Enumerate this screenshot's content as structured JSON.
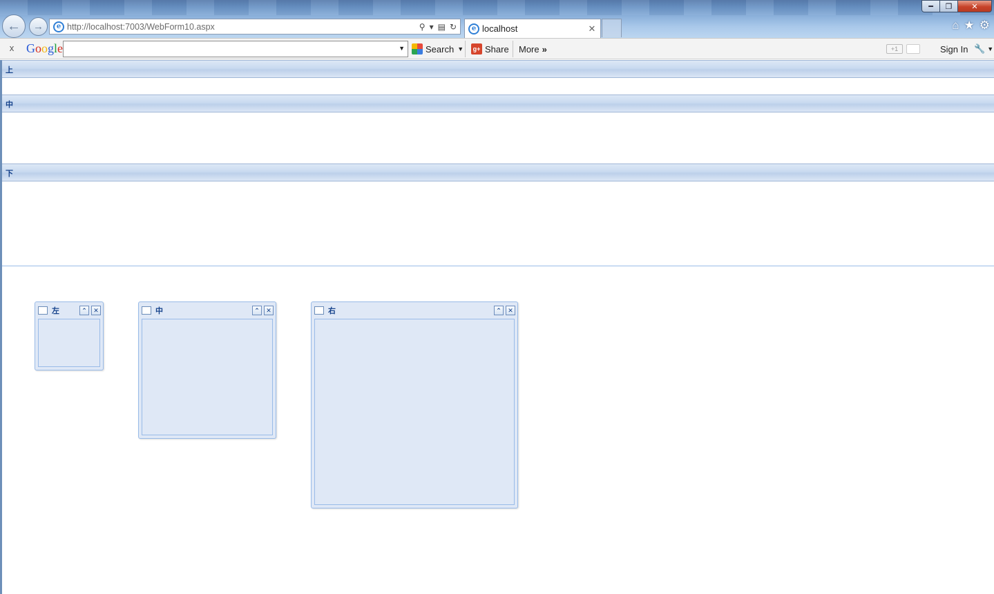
{
  "browser": {
    "window_title": "",
    "address_url": "http://localhost:7003/WebForm10.aspx",
    "tab_title": "localhost",
    "window_buttons": {
      "minimize": "━",
      "maximize": "❐",
      "close": "✕"
    }
  },
  "google_toolbar": {
    "close": "x",
    "logo": [
      "G",
      "o",
      "o",
      "g",
      "l",
      "e"
    ],
    "search_value": "",
    "search_label": "Search",
    "share_label": "Share",
    "more_label": "More",
    "more_glyph": "»",
    "plus_one": "+1",
    "sign_in_label": "Sign In"
  },
  "page": {
    "regions": [
      {
        "title": "上"
      },
      {
        "title": "中"
      },
      {
        "title": "下"
      }
    ],
    "portlets": [
      {
        "title": "左"
      },
      {
        "title": "中"
      },
      {
        "title": "右"
      }
    ]
  },
  "colors": {
    "region_title": "#15428b",
    "panel_border": "#99bbe8",
    "panel_bg": "#dfe8f6"
  },
  "icons": [
    "back-arrow-icon",
    "forward-arrow-icon",
    "ie-page-icon",
    "search-icon",
    "compat-view-icon",
    "refresh-icon",
    "home-icon",
    "favorites-star-icon",
    "gear-icon",
    "wrench-icon",
    "collapse-icon",
    "close-icon"
  ]
}
